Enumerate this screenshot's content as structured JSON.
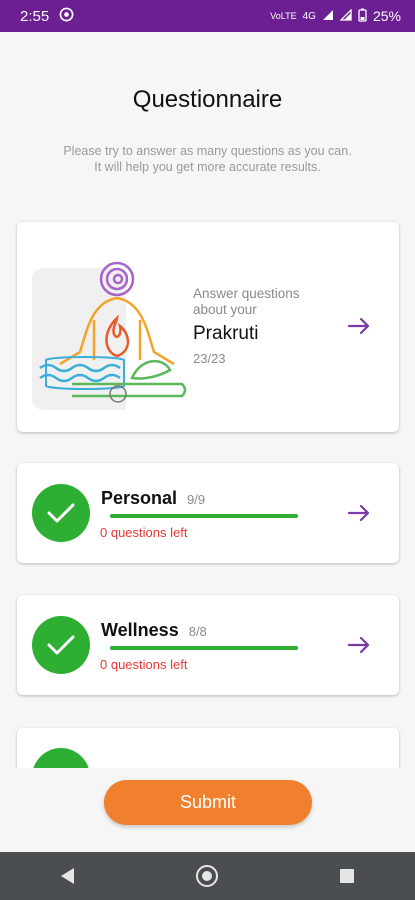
{
  "status_bar": {
    "time": "2:55",
    "volte": "VoLTE",
    "network": "4G",
    "battery": "25%"
  },
  "page": {
    "title": "Questionnaire",
    "subtitle_line1": "Please try to answer as many questions as you can.",
    "subtitle_line2": "It will help you get more accurate results."
  },
  "prakruti_card": {
    "caption": "Answer questions about your",
    "name": "Prakruti",
    "count": "23/23"
  },
  "sections": [
    {
      "title": "Personal",
      "count": "9/9",
      "remaining": "0 questions left",
      "progress": 1.0
    },
    {
      "title": "Wellness",
      "count": "8/8",
      "remaining": "0 questions left",
      "progress": 1.0
    }
  ],
  "submit_label": "Submit",
  "colors": {
    "status_bar": "#6b1f93",
    "accent_arrow": "#7b3aa5",
    "complete_green": "#2eae33",
    "remaining_red": "#e53935",
    "submit_orange": "#f07f2e"
  },
  "icons": [
    "check-icon",
    "arrow-right-icon",
    "yoga-meditation-icon",
    "back-icon",
    "home-icon",
    "recents-icon"
  ]
}
